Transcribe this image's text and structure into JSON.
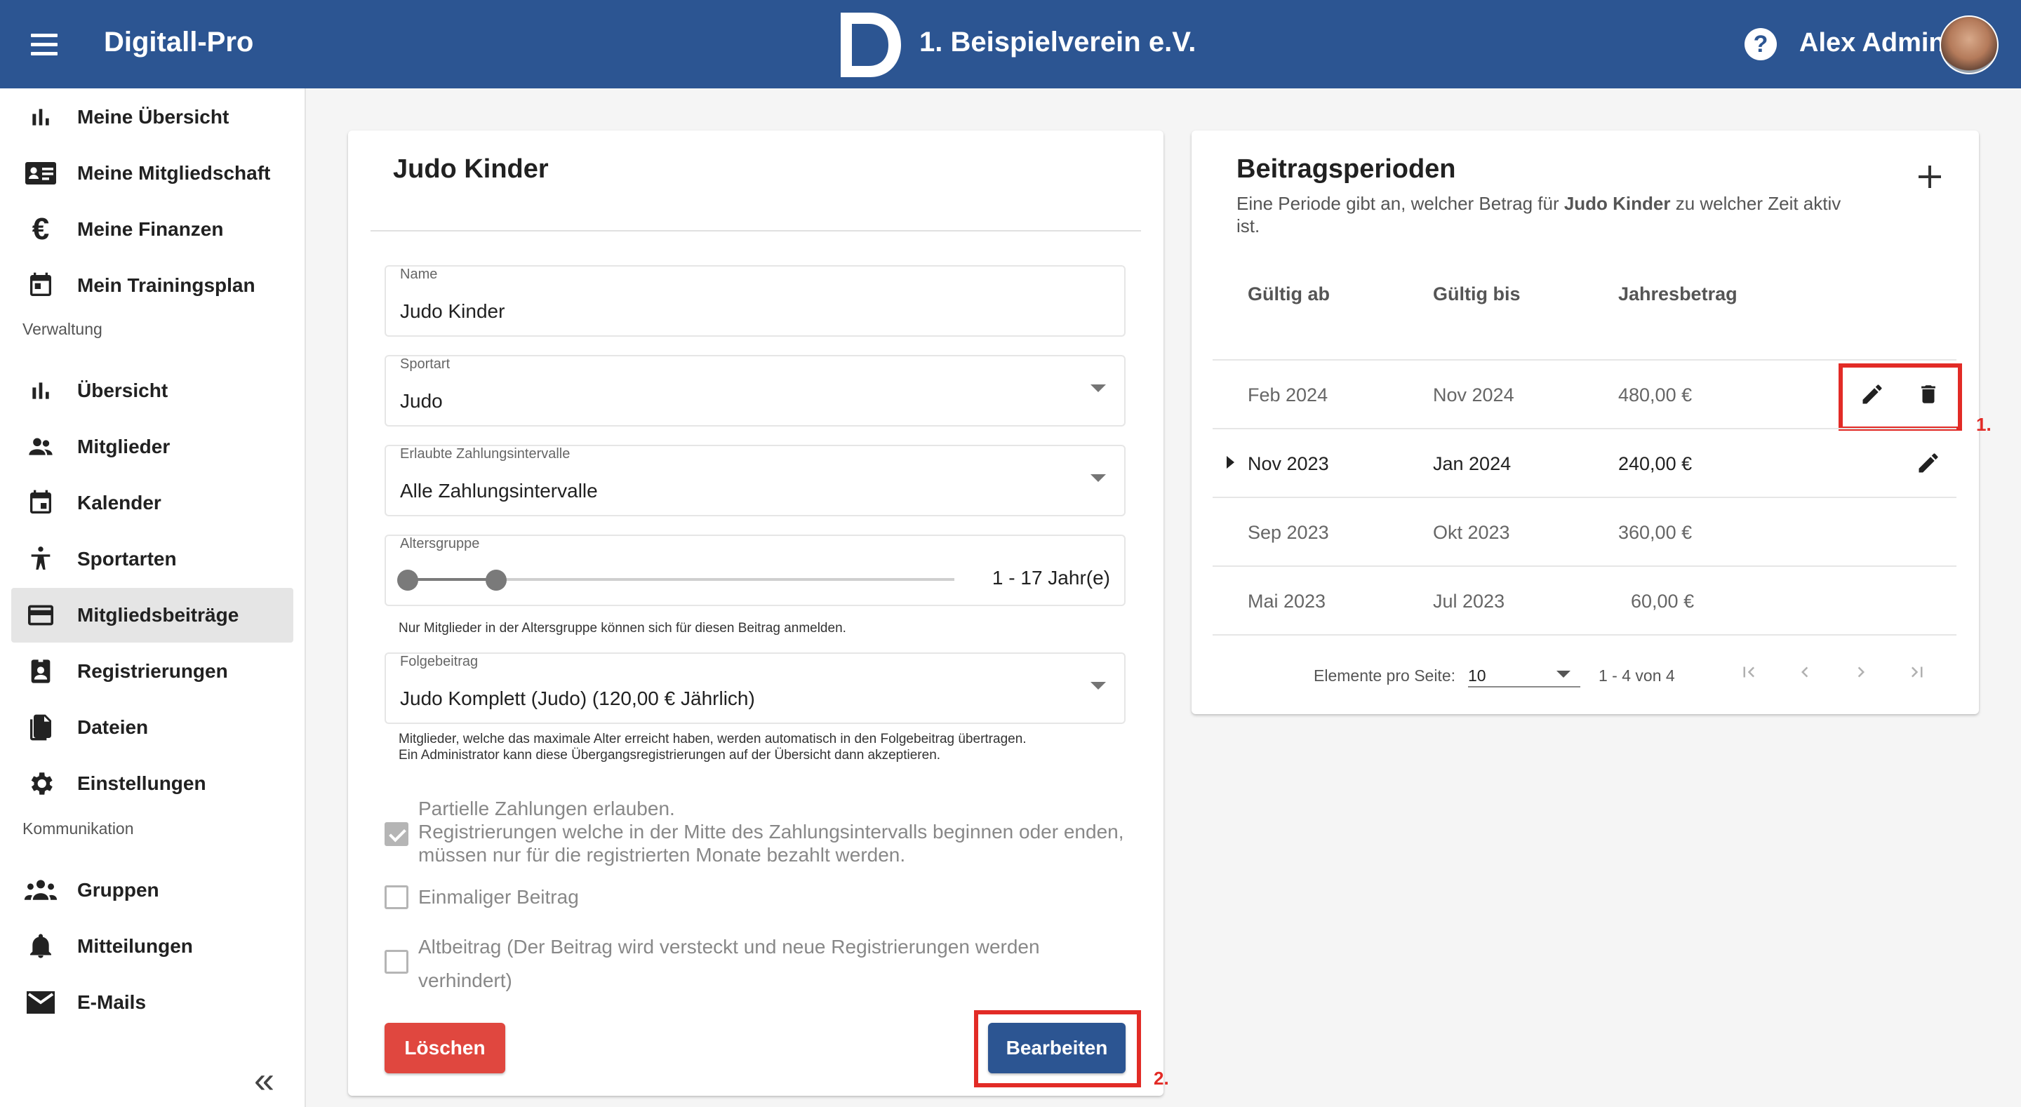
{
  "header": {
    "app_title": "Digitall-Pro",
    "club_name": "1. Beispielverein e.V.",
    "user_name": "Alex Admin",
    "color": "#2c5592"
  },
  "sidebar": {
    "items_top": [
      {
        "label": "Meine Übersicht",
        "icon": "bar-chart-icon"
      },
      {
        "label": "Meine Mitgliedschaft",
        "icon": "id-card-icon"
      },
      {
        "label": "Meine Finanzen",
        "icon": "euro-icon"
      },
      {
        "label": "Mein Trainingsplan",
        "icon": "calendar-today-icon"
      }
    ],
    "section_verwaltung": "Verwaltung",
    "items_verwaltung": [
      {
        "label": "Übersicht",
        "icon": "bar-chart-icon"
      },
      {
        "label": "Mitglieder",
        "icon": "people-icon"
      },
      {
        "label": "Kalender",
        "icon": "calendar-icon"
      },
      {
        "label": "Sportarten",
        "icon": "sport-icon"
      },
      {
        "label": "Mitgliedsbeiträge",
        "icon": "credit-card-icon",
        "active": true
      },
      {
        "label": "Registrierungen",
        "icon": "badge-icon"
      },
      {
        "label": "Dateien",
        "icon": "file-icon"
      },
      {
        "label": "Einstellungen",
        "icon": "gear-icon"
      }
    ],
    "section_kommunikation": "Kommunikation",
    "items_kommunikation": [
      {
        "label": "Gruppen",
        "icon": "groups-icon"
      },
      {
        "label": "Mitteilungen",
        "icon": "bell-icon"
      },
      {
        "label": "E-Mails",
        "icon": "mail-icon"
      }
    ],
    "collapse_glyph": "«"
  },
  "form": {
    "title": "Judo Kinder",
    "name": {
      "label": "Name",
      "value": "Judo Kinder"
    },
    "sportart": {
      "label": "Sportart",
      "value": "Judo"
    },
    "intervals": {
      "label": "Erlaubte Zahlungsintervalle",
      "value": "Alle Zahlungsintervalle"
    },
    "age": {
      "label": "Altersgruppe",
      "value": "1 - 17 Jahr(e)",
      "min": 1,
      "max": 17,
      "hint": "Nur Mitglieder in der Altersgruppe können sich für diesen Beitrag anmelden."
    },
    "followup": {
      "label": "Folgebeitrag",
      "value": "Judo Komplett (Judo) (120,00 € Jährlich)",
      "hint_1": "Mitglieder, welche das maximale Alter erreicht haben, werden automatisch in den Folgebeitrag übertragen.",
      "hint_2": "Ein Administrator kann diese Übergangsregistrierungen auf der Übersicht dann akzeptieren."
    },
    "partial": {
      "line_1": "Partielle Zahlungen erlauben.",
      "line_2": "Registrierungen welche in der Mitte des Zahlungsintervalls beginnen oder enden, müssen nur für die registrierten Monate bezahlt werden.",
      "checked": true
    },
    "onetime": {
      "label": "Einmaliger Beitrag",
      "checked": false
    },
    "legacy": {
      "label": "Altbeitrag (Der Beitrag wird versteckt und neue Registrierungen werden verhindert)",
      "checked": false
    },
    "delete_label": "Löschen",
    "edit_label": "Bearbeiten",
    "delete_color": "#e0473f"
  },
  "periods": {
    "title": "Beitragsperioden",
    "desc_before": "Eine Periode gibt an, welcher Betrag für ",
    "desc_bold": "Judo Kinder",
    "desc_after": " zu welcher Zeit aktiv ist.",
    "columns": [
      "Gültig ab",
      "Gültig bis",
      "Jahresbetrag"
    ],
    "rows": [
      {
        "from": "Feb 2024",
        "to": "Nov 2024",
        "amount": "480,00 €"
      },
      {
        "from": "Nov 2023",
        "to": "Jan 2024",
        "amount": "240,00 €"
      },
      {
        "from": "Sep 2023",
        "to": "Okt 2023",
        "amount": "360,00 €"
      },
      {
        "from": "Mai 2023",
        "to": "Jul 2023",
        "amount": "60,00 €"
      }
    ],
    "pager": {
      "per_page_label": "Elemente pro Seite:",
      "per_page_value": "10",
      "range": "1 - 4 von 4"
    }
  },
  "annotations": {
    "marker_1": "1.",
    "marker_2": "2.",
    "color": "#e22b26"
  }
}
